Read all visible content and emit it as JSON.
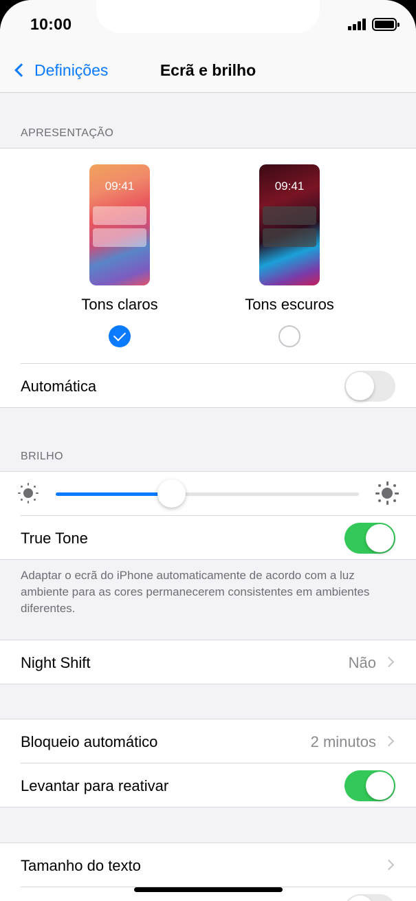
{
  "status_bar": {
    "time": "10:00"
  },
  "nav": {
    "back_label": "Definições",
    "title": "Ecrã e brilho"
  },
  "appearance": {
    "header": "APRESENTAÇÃO",
    "light": {
      "preview_time": "09:41",
      "label": "Tons claros",
      "selected": true
    },
    "dark": {
      "preview_time": "09:41",
      "label": "Tons escuros",
      "selected": false
    },
    "automatic": {
      "label": "Automática",
      "on": false
    }
  },
  "brightness": {
    "header": "BRILHO",
    "level": 0.38,
    "true_tone": {
      "label": "True Tone",
      "on": true
    },
    "footer": "Adaptar o ecrã do iPhone automaticamente de acordo com a luz ambiente para as cores permanecerem consistentes em ambientes diferentes."
  },
  "night_shift": {
    "label": "Night Shift",
    "value": "Não"
  },
  "lock": {
    "auto_lock": {
      "label": "Bloqueio automático",
      "value": "2 minutos"
    },
    "raise_to_wake": {
      "label": "Levantar para reativar",
      "on": true
    }
  },
  "text": {
    "text_size": {
      "label": "Tamanho do texto"
    }
  },
  "colors": {
    "accent": "#0a7aff",
    "toggle_on": "#34c759",
    "toggle_off": "#e9e9ea"
  }
}
